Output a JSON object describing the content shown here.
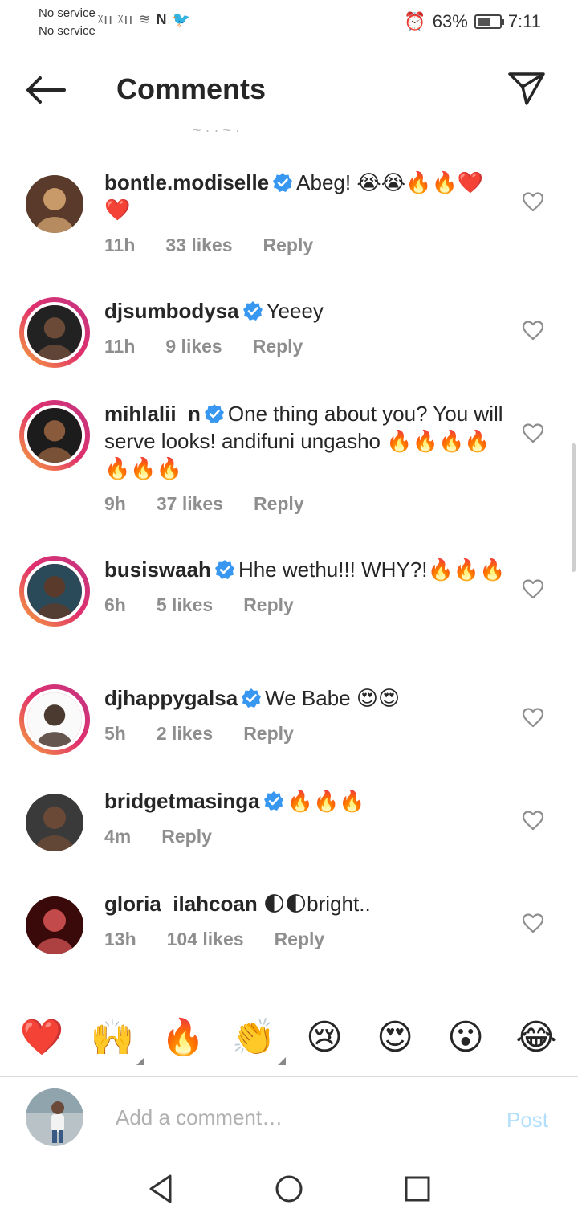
{
  "status_bar": {
    "sim1": "No service",
    "sim2": "No service",
    "battery": "63%",
    "battery_level": 0.63,
    "time": "7:11"
  },
  "header": {
    "title": "Comments"
  },
  "comments": [
    {
      "username": "bontle.modiselle",
      "verified": true,
      "text": "Abeg! 😭😭🔥🔥❤️❤️",
      "time": "11h",
      "likes": "33 likes",
      "reply": "Reply"
    },
    {
      "username": "djsumbodysa",
      "verified": true,
      "text": "Yeeey",
      "time": "11h",
      "likes": "9 likes",
      "reply": "Reply"
    },
    {
      "username": "mihlalii_n",
      "verified": true,
      "text": "One thing about you? You will serve looks! andifuni ungasho 🔥🔥🔥🔥🔥🔥🔥",
      "time": "9h",
      "likes": "37 likes",
      "reply": "Reply"
    },
    {
      "username": "busiswaah",
      "verified": true,
      "text": "Hhe wethu!!! WHY?!🔥🔥🔥",
      "time": "6h",
      "likes": "5 likes",
      "reply": "Reply"
    },
    {
      "username": "djhappygalsa",
      "verified": true,
      "text": "We Babe 😍😍",
      "time": "5h",
      "likes": "2 likes",
      "reply": "Reply"
    },
    {
      "username": "bridgetmasinga",
      "verified": true,
      "text": "🔥🔥🔥",
      "time": "4m",
      "likes": "",
      "reply": "Reply"
    },
    {
      "username": "gloria_ilahcoan",
      "verified": false,
      "text": "🌓🌓bright..",
      "time": "13h",
      "likes": "104 likes",
      "reply": "Reply"
    }
  ],
  "reactions": [
    "❤️",
    "🙌",
    "🔥",
    "👏",
    "😢",
    "😍",
    "😮",
    "😂"
  ],
  "composer": {
    "placeholder": "Add a comment…",
    "post_label": "Post"
  },
  "colors": {
    "verified": "#3897f0",
    "post": "#b2dffc",
    "meta": "#8e8e8e"
  }
}
